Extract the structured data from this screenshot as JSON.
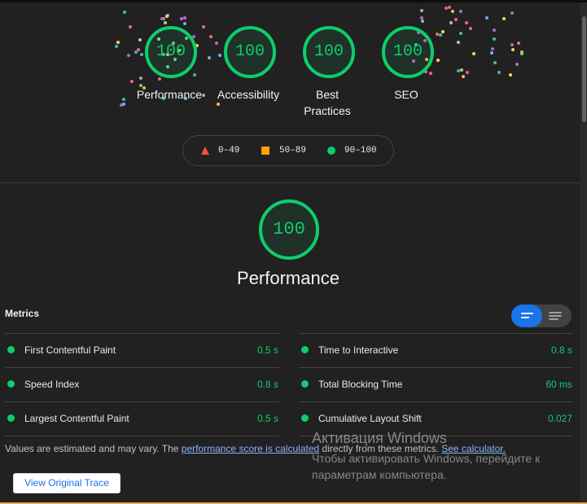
{
  "categories": [
    {
      "score": "100",
      "label": "Performance"
    },
    {
      "score": "100",
      "label": "Accessibility"
    },
    {
      "score": "100",
      "label": "Best Practices"
    },
    {
      "score": "100",
      "label": "SEO"
    }
  ],
  "legend": {
    "fail": "0–49",
    "average": "50–89",
    "pass": "90–100",
    "colors": {
      "fail": "#ff4e42",
      "average": "#ffa400",
      "pass": "#0cce6b"
    }
  },
  "performance": {
    "score": "100",
    "title": "Performance"
  },
  "metrics": {
    "title": "Metrics",
    "items": [
      {
        "name": "First Contentful Paint",
        "value": "0.5 s"
      },
      {
        "name": "Time to Interactive",
        "value": "0.8 s"
      },
      {
        "name": "Speed Index",
        "value": "0.8 s"
      },
      {
        "name": "Total Blocking Time",
        "value": "60 ms"
      },
      {
        "name": "Largest Contentful Paint",
        "value": "0.5 s"
      },
      {
        "name": "Cumulative Layout Shift",
        "value": "0.027"
      }
    ]
  },
  "note": {
    "prefix": "Values are estimated and may vary. The ",
    "link1": "performance score is calculated",
    "middle": " directly from these metrics. ",
    "link2": "See calculator."
  },
  "trace_button": "View Original Trace",
  "watermark": {
    "title": "Активация Windows",
    "body": "Чтобы активировать Windows, перейдите к параметрам компьютера."
  }
}
